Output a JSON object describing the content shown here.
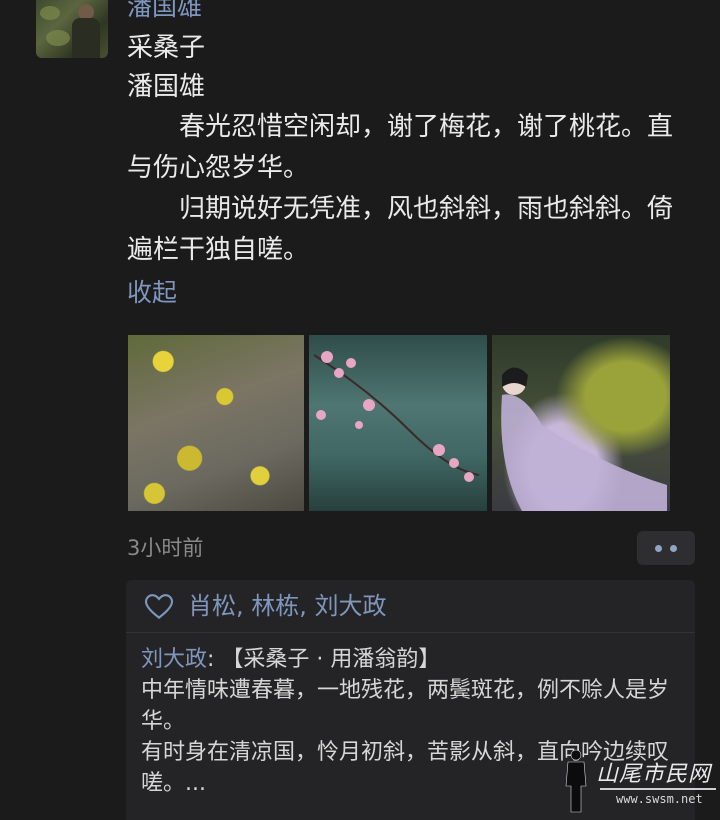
{
  "post": {
    "author": "潘国雄",
    "poem_title": "采桑子",
    "poem_author": "潘国雄",
    "stanza1": "春光忍惜空闲却，谢了梅花，谢了桃花。直与伤心怨岁华。",
    "stanza2": "归期说好无凭准，风也斜斜，雨也斜斜。倚遍栏干独自嗟。",
    "collapse_label": "收起",
    "time": "3小时前"
  },
  "likes": {
    "names": [
      "肖松",
      "林栋",
      "刘大政"
    ],
    "separator": ", "
  },
  "comment": {
    "author": "刘大政",
    "colon": ": ",
    "title": "【采桑子 · 用潘翁韵】",
    "line1": "中年情味遭春暮，一地残花，两鬓斑花，例不赊人是岁华。",
    "line2": "有时身在清凉国，怜月初斜，苦影从斜，直向吟边续叹嗟。..."
  },
  "watermark": {
    "title": "山尾市民网",
    "url": "www.swsm.net"
  },
  "colors": {
    "background": "#1b1b1c",
    "link": "#7f96bd",
    "text": "#eaeaea",
    "meta": "#8a8a8a"
  }
}
